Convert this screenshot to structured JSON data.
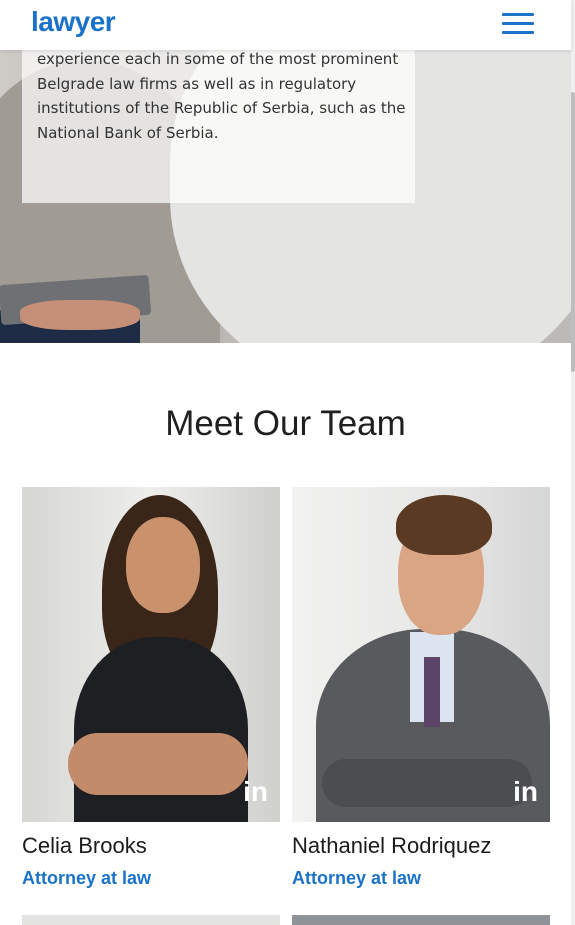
{
  "header": {
    "logo": "lawyer",
    "menu_icon": "hamburger-icon"
  },
  "hero": {
    "text": "experience each in some of the most prominent Belgrade law firms as well as in regulatory institutions of the Republic of Serbia, such as the National Bank of Serbia."
  },
  "team": {
    "title": "Meet Our Team",
    "members": [
      {
        "name": "Celia Brooks",
        "role": "Attorney at law",
        "social_icon": "linkedin-icon",
        "social_label": "in"
      },
      {
        "name": "Nathaniel Rodriquez",
        "role": "Attorney at law",
        "social_icon": "linkedin-icon",
        "social_label": "in"
      }
    ]
  },
  "colors": {
    "accent": "#1a73c8",
    "heading": "#1f1f1f",
    "body_text": "#333333"
  }
}
